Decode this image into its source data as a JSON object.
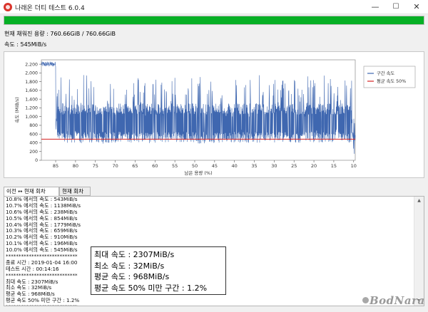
{
  "window": {
    "title": "나래온 더티 테스트 6.0.4",
    "minimize_glyph": "—",
    "maximize_glyph": "☐",
    "close_glyph": "✕"
  },
  "progress": {
    "fraction": 1.0,
    "color": "#06b025"
  },
  "status": {
    "written": "현재 채워진 용량 : 760.66GiB / 760.66GiB",
    "speed": "속도 : 545MiB/s"
  },
  "chart_data": {
    "type": "line",
    "ylabel": "속도 (MiB/s)",
    "xlabel": "남은 용량 (%)",
    "x_reversed": true,
    "xlim": [
      9.6,
      88.6
    ],
    "ylim": [
      0,
      2300
    ],
    "x_ticks": [
      85,
      80,
      75,
      70,
      65,
      60,
      55,
      50,
      45,
      40,
      35,
      30,
      25,
      20,
      15,
      10
    ],
    "y_ticks": [
      0,
      200,
      400,
      600,
      800,
      1000,
      1200,
      1400,
      1600,
      1800,
      2000,
      2200
    ],
    "y_tick_labels": [
      "0",
      "200",
      "400",
      "600",
      "800",
      "1,000",
      "1,200",
      "1,400",
      "1,600",
      "1,800",
      "2,000",
      "2,200"
    ],
    "series": [
      {
        "name": "구간 속도",
        "color": "#3f67b0",
        "band": {
          "low": 400,
          "high": 1300
        },
        "peak": {
          "low": 1000,
          "high": 1960
        },
        "dip": {
          "low": 380,
          "high": 700
        },
        "cache_region": {
          "x_from": 88.6,
          "x_to": 84.6,
          "value": 2200
        },
        "end_dip": {
          "x_from": 10.5,
          "x_to": 9.6,
          "value": 120
        }
      },
      {
        "name": "평균 속도 50%",
        "color": "#d42020",
        "value": 484
      }
    ],
    "legend_position": "top-right"
  },
  "tabs": [
    {
      "label": "이전 ↔ 현재 회차",
      "active": true
    },
    {
      "label": "현재 회차",
      "active": false
    }
  ],
  "log": {
    "lines": [
      "10.8% 에서의 속도 : 543MiB/s",
      "10.7% 에서의 속도 : 1138MiB/s",
      "10.6% 에서의 속도 : 238MiB/s",
      "10.5% 에서의 속도 : 854MiB/s",
      "10.4% 에서의 속도 : 1779MiB/s",
      "10.3% 에서의 속도 : 659MiB/s",
      "10.2% 에서의 속도 : 910MiB/s",
      "10.1% 에서의 속도 : 196MiB/s",
      "10.0% 에서의 속도 : 545MiB/s",
      "****************************",
      "종료 시간 : 2019-01-04 16:00",
      "테스트 시간 : 00:14:16",
      "****************************",
      "최대 속도 : 2307MiB/s",
      "최소 속도 : 32MiB/s",
      "평균 속도 : 968MiB/s",
      "평균 속도 50% 미만 구간 : 1.2%",
      "****************************"
    ]
  },
  "summary": {
    "max": "최대 속도 : 2307MiB/s",
    "min": "최소 속도 : 32MiB/s",
    "avg": "평균 속도 : 968MiB/s",
    "below": "평균 속도 50% 미만 구간 : 1.2%"
  },
  "watermark": "BodNara",
  "colors": {
    "accent": "#06b025",
    "series": "#3f67b0",
    "avg_line": "#d42020"
  }
}
